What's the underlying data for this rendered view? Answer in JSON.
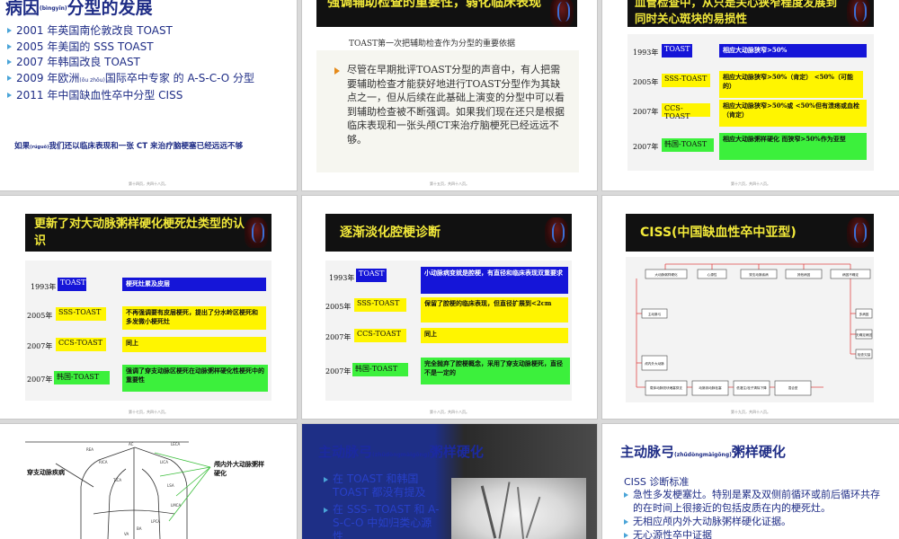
{
  "s1": {
    "title": "病因",
    "title_ruby": "(bìngyīn)",
    "title_rest": "分型的发展",
    "items": [
      "2001 年英国南伦敦改良 TOAST",
      "2005 年美国的 SSS TOAST",
      "2007 年韩国改良 TOAST",
      "2009 年欧洲",
      "2011 年中国缺血性卒中分型 CISS"
    ],
    "item4_ruby": "(ōu zhōu)",
    "item4_rest": "国际卒中专家 的 A-S-C-O 分型",
    "note_a": "如果",
    "note_ruby": "(rúguǒ)",
    "note_b": "我们还以临床表现和一张 CT 来治疗脑梗塞已经远远不够",
    "footer": "第十四页，共四十八页。"
  },
  "s2": {
    "title": "强调辅助检查的重要性，弱化临床表现",
    "subtitle": "TOAST第一次把辅助检查作为分型的重要依据",
    "body": "尽管在早期批评TOAST分型的声音中，有人把需要辅助检查才能获好地进行TOAST分型作为其缺点之一，但从后续在此基础上演变的分型中可以看到辅助检查被不断强调。如果我们现在还只是根据临床表现和一张头颅CT来治疗脑梗死已经远远不够。",
    "footer": "第十五页，共四十八页。"
  },
  "s3": {
    "title": "血管检查中，从只是关心狭窄程度发展到同时关心斑块的易损性",
    "rows": [
      {
        "year": "1993年",
        "tag": "TOAST",
        "text": "相应大动脉狭窄>50%"
      },
      {
        "year": "2005年",
        "tag": "SSS-TOAST",
        "text": "相应大动脉狭窄>50%（肯定） <50%（可能的）"
      },
      {
        "year": "2007年",
        "tag": "CCS-TOAST",
        "text": "相应大动脉狭窄>50%或 <50%但有溃疡或血栓（肯定）"
      },
      {
        "year": "2007年",
        "tag": "韩国-TOAST",
        "text": "相应大动脉粥样硬化 而狭窄>50%作为亚型"
      }
    ],
    "footer": "第十六页，共四十八页。"
  },
  "s4": {
    "title": "更新了对大动脉粥样硬化梗死灶类型的认识",
    "rows": [
      {
        "year": "1993年",
        "tag": "TOAST",
        "text": "梗死灶累及皮层"
      },
      {
        "year": "2005年",
        "tag": "SSS-TOAST",
        "text": "不再强调要有皮层梗死，提出了分水岭区梗死和多发微小梗死灶"
      },
      {
        "year": "2007年",
        "tag": "CCS-TOAST",
        "text": "同上"
      },
      {
        "year": "2007年",
        "tag": "韩国-TOAST",
        "text": "强调了穿支动脉区梗死在动脉粥样硬化性梗死中的重要性"
      }
    ],
    "footer": "第十七页，共四十八页。"
  },
  "s5": {
    "title": "逐渐淡化腔梗诊断",
    "rows": [
      {
        "year": "1993年",
        "tag": "TOAST",
        "text": "小动脉病变就是腔梗，有直径和临床表现双重要求"
      },
      {
        "year": "2005年",
        "tag": "SSS-TOAST",
        "text": "保留了腔梗的临床表现，但直径扩展到<2cm"
      },
      {
        "year": "2007年",
        "tag": "CCS-TOAST",
        "text": "同上"
      },
      {
        "year": "2007年",
        "tag": "韩国-TOAST",
        "text": "完全抛弃了腔梗概念，采用了穿支动脉梗死，直径不是一定的"
      }
    ],
    "footer": "第十八页，共四十八页。"
  },
  "s6": {
    "title": "CISS(中国缺血性卒中亚型)",
    "top_boxes": [
      "大动脉粥样硬化",
      "心源性",
      "穿支动脉疾病",
      "其他病因",
      "病因不确定"
    ],
    "left_boxes": [
      "主动脉弓",
      "颅内外大动脉"
    ],
    "right_boxes": [
      "多病因",
      "无确定病因",
      "检查欠缺"
    ],
    "bottom_boxes": [
      "载体动脉斑块堵塞穿支",
      "动脉到动脉栓塞",
      "低灌注/栓子清除下降",
      "混合型"
    ],
    "footer": "第十九页，共四十八页。"
  },
  "s7": {
    "label_left": "穿支动脉疾病",
    "label_right": "颅内外大动脉粥样硬化",
    "vessels": [
      "AC",
      "LECA",
      "LICA",
      "RICA",
      "REA",
      "TICA",
      "LSA",
      "LMCA",
      "LPCA",
      "BA",
      "VA"
    ]
  },
  "s8": {
    "title": "主动脉弓",
    "title_ruby": "(zhǔdòngmàigōng)",
    "title_rest": "粥样硬化",
    "items": [
      "在 TOAST 和韩国 TOAST 都没有提及",
      "在 SSS- TOAST 和 A-S-C-O 中如归类心源性"
    ]
  },
  "s9": {
    "title": "主动脉弓",
    "title_ruby": "(zhǔdòngmàigōng)",
    "title_rest": "粥样硬化",
    "heading": "CISS 诊断标准",
    "items": [
      "急性多发梗塞灶。特别是累及双侧前循环或前后循环共存的在时间上很接近的包括皮质在内的梗死灶。",
      "无相应颅内外大动脉粥样硬化证据。",
      "无心源性卒中证据"
    ]
  }
}
